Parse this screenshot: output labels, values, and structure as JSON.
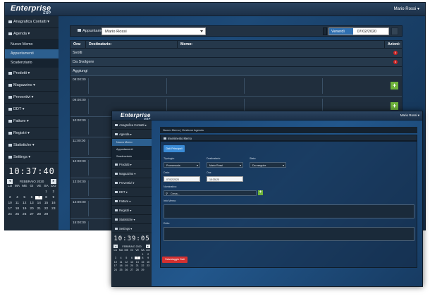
{
  "app": {
    "logo": "Enterprise",
    "logo_sub": "ERP",
    "user": "Mario Rossi ▾"
  },
  "sidebar": {
    "items": [
      {
        "label": "Anagrafica Contatti ▾"
      },
      {
        "label": "Agenda ▾"
      },
      {
        "label": "Prodotti ▾"
      },
      {
        "label": "Magazzino ▾"
      },
      {
        "label": "Preventivi ▾"
      },
      {
        "label": "DDT ▾"
      },
      {
        "label": "Fatture ▾"
      },
      {
        "label": "Registri ▾"
      },
      {
        "label": "Statistiche ▾"
      },
      {
        "label": "Settings ▾"
      }
    ],
    "subitems": [
      {
        "label": "Nuovo Memo"
      },
      {
        "label": "Appuntamenti"
      },
      {
        "label": "Scadenziario"
      }
    ]
  },
  "clock1": "10:37:40",
  "clock2": "10:39:05",
  "calendar": {
    "month": "FEBBRAIO 2020",
    "prev": "◂",
    "next": "▸",
    "weekdays": [
      "LU",
      "MA",
      "ME",
      "GI",
      "VE",
      "SA",
      "DO"
    ],
    "days": [
      "",
      "",
      "",
      "",
      "",
      "1",
      "2",
      "3",
      "4",
      "5",
      "6",
      "7",
      "8",
      "9",
      "10",
      "11",
      "12",
      "13",
      "14",
      "15",
      "16",
      "17",
      "18",
      "19",
      "20",
      "21",
      "22",
      "23",
      "24",
      "25",
      "26",
      "27",
      "28",
      "29"
    ],
    "selected": "7"
  },
  "appointments": {
    "label": "Appuntamenti",
    "doctor": "Mario Rossi",
    "day": "Venerdì",
    "date": "07/02/2020",
    "columns": {
      "ora": "Ora:",
      "destinatario": "Destinatario:",
      "memo": "Memo:",
      "azioni": "Azioni:"
    },
    "rows": [
      {
        "label": "Svolti",
        "badge": "0"
      },
      {
        "label": "Da Svolgere",
        "badge": "0"
      },
      {
        "label": "Aggiungi",
        "badge": ""
      }
    ],
    "times": [
      "08:00:00",
      "09:00:00",
      "10:00:00",
      "11:00:00",
      "12:00:00",
      "13:00:00",
      "14:00:00",
      "15:00:00"
    ],
    "add": "+"
  },
  "memo_form": {
    "breadcrumb": "Nuovo Memo  |  Gestione Agenda",
    "panel_title": "Inserimento Memo",
    "tab": "Dati Principali",
    "tipologia_label": "Tipologia:",
    "tipologia": "Promemoria",
    "destinatario_label": "Destinatario:",
    "destinatario": "Mario Rossi",
    "stato_label": "Stato:",
    "stato": "Da eseguire",
    "data_label": "Data:",
    "data": "07/02/2020",
    "ora_label": "Ora:",
    "ora": "10:35:20",
    "nominativo_label": "Nominativo:",
    "nominativo_icon": "search-icon",
    "nominativo": "Cerca...",
    "info_label": "Info Memo:",
    "esito_label": "Esito:",
    "save": "Salvataggio Dati",
    "add": "+"
  }
}
